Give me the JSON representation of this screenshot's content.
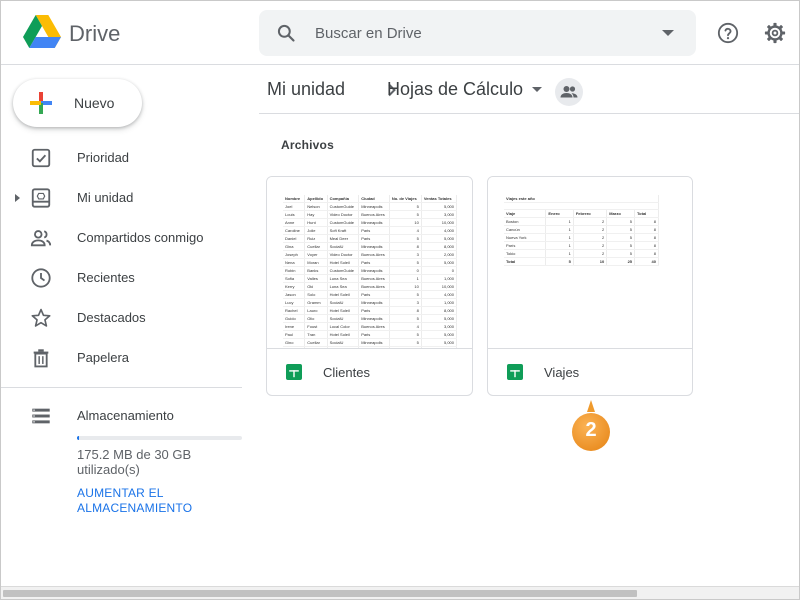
{
  "app": {
    "name": "Drive"
  },
  "search": {
    "placeholder": "Buscar en Drive"
  },
  "header": {
    "help_icon": "help-circle-icon",
    "settings_icon": "gear-icon"
  },
  "sidebar": {
    "new_button": "Nuevo",
    "items": [
      {
        "label": "Prioridad",
        "icon": "priority-check-icon"
      },
      {
        "label": "Mi unidad",
        "icon": "my-drive-icon"
      },
      {
        "label": "Compartidos conmigo",
        "icon": "shared-people-icon"
      },
      {
        "label": "Recientes",
        "icon": "clock-icon"
      },
      {
        "label": "Destacados",
        "icon": "star-icon"
      },
      {
        "label": "Papelera",
        "icon": "trash-icon"
      }
    ],
    "storage": {
      "label": "Almacenamiento",
      "usage": "175.2 MB de 30 GB utilizado(s)",
      "used_fraction": 0.006,
      "upgrade": "AUMENTAR EL ALMACENAMIENTO"
    }
  },
  "breadcrumb": {
    "root": "Mi unidad",
    "current": "Hojas de Cálculo"
  },
  "files_section": {
    "title": "Archivos"
  },
  "files": [
    {
      "name": "Clientes",
      "icon": "sheets-icon",
      "preview": {
        "header": [
          "Nombre",
          "Apellido",
          "Compañía",
          "Ciudad",
          "No. de Viajes",
          "Ventas Totales"
        ],
        "rows": [
          [
            "Joel",
            "Nelson",
            "CustomGuide",
            "Minneapolis",
            "5",
            "5,000"
          ],
          [
            "Louis",
            "Hay",
            "Video Doctor",
            "Buenos Aires",
            "5",
            "3,000"
          ],
          [
            "Anne",
            "Hunt",
            "CustomGuide",
            "Minneapolis",
            "10",
            "10,000"
          ],
          [
            "Caroline",
            "Jolie",
            "Soft Kraft",
            "Paris",
            "4",
            "4,000"
          ],
          [
            "Daniel",
            "Ruiz",
            "Meal Deer",
            "Paris",
            "5",
            "5,000"
          ],
          [
            "Gina",
            "Cuellar",
            "SocialU",
            "Minneapolis",
            "8",
            "8,000"
          ],
          [
            "Joseph",
            "Voyer",
            "Video Doctor",
            "Buenos Aires",
            "3",
            "2,000"
          ],
          [
            "Nena",
            "Moran",
            "Hotel Soleil",
            "Paris",
            "5",
            "5,000"
          ],
          [
            "Robin",
            "Banks",
            "CustomGuide",
            "Minneapolis",
            "0",
            "0"
          ],
          [
            "Sofia",
            "Valles",
            "Luna Sea",
            "Buenos Aires",
            "1",
            "1,000"
          ],
          [
            "Kerry",
            "Oki",
            "Luna Sea",
            "Buenos Aires",
            "10",
            "10,000"
          ],
          [
            "Jason",
            "Solo",
            "Hotel Soleil",
            "Paris",
            "5",
            "4,000"
          ],
          [
            "Lucy",
            "Gramm",
            "SocialU",
            "Minneapolis",
            "3",
            "1,000"
          ],
          [
            "Rachel",
            "Lauro",
            "Hotel Soleil",
            "Paris",
            "8",
            "8,000"
          ],
          [
            "Guido",
            "Olio",
            "SocialU",
            "Minneapolis",
            "5",
            "5,000"
          ],
          [
            "Irene",
            "Foust",
            "Local Color",
            "Buenos Aires",
            "4",
            "3,000"
          ],
          [
            "Paul",
            "Tran",
            "Hotel Soleil",
            "Paris",
            "5",
            "5,000"
          ],
          [
            "Gino",
            "Cuellar",
            "SocialU",
            "Minneapolis",
            "5",
            "5,000"
          ],
          [
            "Christian",
            "Ray",
            "Local Color",
            "Minneapolis",
            "3",
            "3,000"
          ],
          [
            "Dan",
            "Druff",
            "Meal Deer",
            "Paris",
            "4",
            "4,000"
          ],
          [
            "Dario",
            "Moreno",
            "Luna Sea",
            "Buenos Aires",
            "2",
            "2,000"
          ],
          [
            "Janell",
            "Lee",
            "Luna Sea",
            "Buenos Aires",
            "5",
            "5,000"
          ],
          [
            "Lola",
            "Pickett",
            "Local Color",
            "Minneapolis",
            "3",
            "3,000"
          ]
        ]
      }
    },
    {
      "name": "Viajes",
      "icon": "sheets-icon",
      "preview": {
        "title": "Viajes este año",
        "header": [
          "Viaje",
          "Enero",
          "Febrero",
          "Marzo",
          "Total"
        ],
        "rows": [
          [
            "Boston",
            "1",
            "2",
            "5",
            "8"
          ],
          [
            "Cancún",
            "1",
            "2",
            "5",
            "8"
          ],
          [
            "Nueva York",
            "1",
            "2",
            "5",
            "8"
          ],
          [
            "París",
            "1",
            "2",
            "5",
            "8"
          ],
          [
            "Tokio",
            "1",
            "2",
            "5",
            "8"
          ],
          [
            "Total",
            "5",
            "10",
            "25",
            "40"
          ]
        ]
      }
    }
  ],
  "step_marker": {
    "number": "2",
    "color": "#f39c34"
  },
  "colors": {
    "accent": "#1a73e8",
    "sheets_green": "#0f9d58",
    "plus_red": "#ea4335",
    "plus_blue": "#4285f4",
    "plus_yellow": "#fbbc04",
    "plus_green": "#34a853"
  }
}
